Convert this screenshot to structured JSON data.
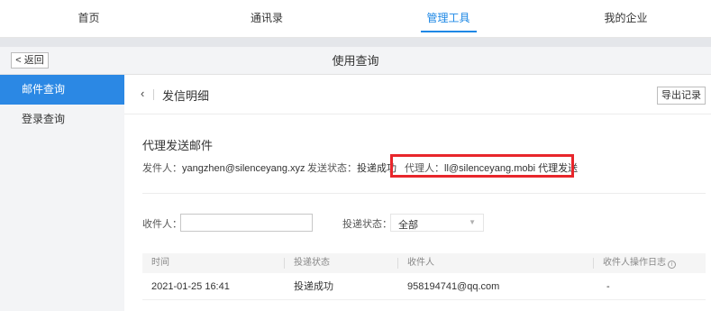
{
  "nav": {
    "tabs": [
      {
        "label": "首页"
      },
      {
        "label": "通讯录"
      },
      {
        "label": "管理工具"
      },
      {
        "label": "我的企业"
      }
    ]
  },
  "header": {
    "back_label": "< 返回",
    "page_title": "使用查询"
  },
  "sidebar": {
    "items": [
      {
        "label": "邮件查询"
      },
      {
        "label": "登录查询"
      }
    ]
  },
  "detail": {
    "title": "发信明细",
    "export_label": "导出记录",
    "section_title": "代理发送邮件",
    "sender_label": "发件人：",
    "sender_value": "yangzhen@silenceyang.xyz",
    "status_label": "发送状态：",
    "status_value": "投递成功",
    "agent_label": "代理人：",
    "agent_value": "ll@silenceyang.mobi 代理发送"
  },
  "filters": {
    "recipient_label": "收件人：",
    "recipient_value": "",
    "delivery_label": "投递状态：",
    "delivery_value": "全部"
  },
  "table": {
    "headers": [
      "时间",
      "投递状态",
      "收件人",
      "收件人操作日志"
    ],
    "rows": [
      {
        "time": "2021-01-25 16:41",
        "status": "投递成功",
        "recipient": "958194741@qq.com",
        "log": "-"
      }
    ]
  },
  "colors": {
    "accent": "#2b88e4",
    "highlight_border": "#e8262b"
  }
}
